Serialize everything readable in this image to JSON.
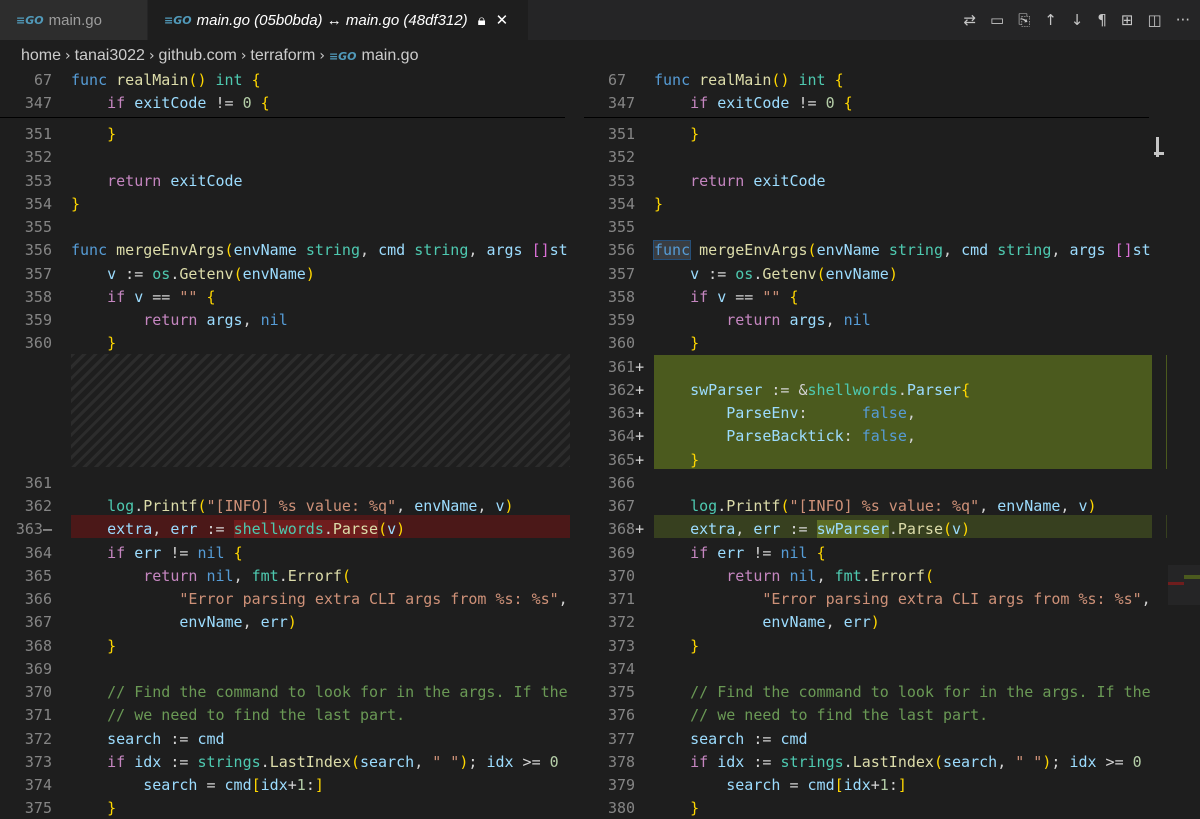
{
  "tabs": [
    {
      "label": "main.go",
      "icon": "go-file-icon"
    },
    {
      "label": "main.go (05b0bda) ↔ main.go (48df312)",
      "icon": "go-file-icon"
    }
  ],
  "toolbar_icons": [
    "git-compare-icon",
    "open-file-icon",
    "open-changes-icon",
    "arrow-up-icon",
    "arrow-down-icon",
    "pilcrow-icon",
    "book-icon",
    "split-editor-icon",
    "more-icon"
  ],
  "breadcrumb": [
    "home",
    "tanai3022",
    "github.com",
    "terraform",
    "main.go"
  ],
  "left": {
    "sticky": [
      {
        "ln": "67",
        "code": "func realMain() int {"
      },
      {
        "ln": "347",
        "code": "    if exitCode != 0 {"
      }
    ],
    "lines": [
      {
        "ln": "351",
        "code": "    }"
      },
      {
        "ln": "352",
        "code": ""
      },
      {
        "ln": "353",
        "code": "    return exitCode"
      },
      {
        "ln": "354",
        "code": "}"
      },
      {
        "ln": "355",
        "code": ""
      },
      {
        "ln": "356",
        "code": "func mergeEnvArgs(envName string, cmd string, args []st"
      },
      {
        "ln": "357",
        "code": "    v := os.Getenv(envName)"
      },
      {
        "ln": "358",
        "code": "    if v == \"\" {"
      },
      {
        "ln": "359",
        "code": "        return args, nil"
      },
      {
        "ln": "360",
        "code": "    }"
      },
      {
        "ln": "361",
        "code": ""
      },
      {
        "ln": "362",
        "code": "    log.Printf(\"[INFO] %s value: %q\", envName, v)"
      },
      {
        "ln": "363",
        "code": "    extra, err := shellwords.Parse(v)"
      },
      {
        "ln": "364",
        "code": "    if err != nil {"
      },
      {
        "ln": "365",
        "code": "        return nil, fmt.Errorf("
      },
      {
        "ln": "366",
        "code": "            \"Error parsing extra CLI args from %s: %s\","
      },
      {
        "ln": "367",
        "code": "            envName, err)"
      },
      {
        "ln": "368",
        "code": "    }"
      },
      {
        "ln": "369",
        "code": ""
      },
      {
        "ln": "370",
        "code": "    // Find the command to look for in the args. If the"
      },
      {
        "ln": "371",
        "code": "    // we need to find the last part."
      },
      {
        "ln": "372",
        "code": "    search := cmd"
      },
      {
        "ln": "373",
        "code": "    if idx := strings.LastIndex(search, \" \"); idx >= 0"
      },
      {
        "ln": "374",
        "code": "        search = cmd[idx+1:]"
      },
      {
        "ln": "375",
        "code": "    }"
      }
    ]
  },
  "right": {
    "sticky": [
      {
        "ln": "67",
        "code": "func realMain() int {"
      },
      {
        "ln": "347",
        "code": "    if exitCode != 0 {"
      }
    ],
    "lines": [
      {
        "ln": "351",
        "code": "    }"
      },
      {
        "ln": "352",
        "code": ""
      },
      {
        "ln": "353",
        "code": "    return exitCode"
      },
      {
        "ln": "354",
        "code": "}"
      },
      {
        "ln": "355",
        "code": ""
      },
      {
        "ln": "356",
        "code": "func mergeEnvArgs(envName string, cmd string, args []st"
      },
      {
        "ln": "357",
        "code": "    v := os.Getenv(envName)"
      },
      {
        "ln": "358",
        "code": "    if v == \"\" {"
      },
      {
        "ln": "359",
        "code": "        return args, nil"
      },
      {
        "ln": "360",
        "code": "    }"
      },
      {
        "ln": "361",
        "code": "",
        "sign": "+"
      },
      {
        "ln": "362",
        "code": "    swParser := &shellwords.Parser{",
        "sign": "+"
      },
      {
        "ln": "363",
        "code": "        ParseEnv:      false,",
        "sign": "+"
      },
      {
        "ln": "364",
        "code": "        ParseBacktick: false,",
        "sign": "+"
      },
      {
        "ln": "365",
        "code": "    }",
        "sign": "+"
      },
      {
        "ln": "366",
        "code": ""
      },
      {
        "ln": "367",
        "code": "    log.Printf(\"[INFO] %s value: %q\", envName, v)"
      },
      {
        "ln": "368",
        "code": "    extra, err := swParser.Parse(v)",
        "sign": "+"
      },
      {
        "ln": "369",
        "code": "    if err != nil {"
      },
      {
        "ln": "370",
        "code": "        return nil, fmt.Errorf("
      },
      {
        "ln": "371",
        "code": "            \"Error parsing extra CLI args from %s: %s\","
      },
      {
        "ln": "372",
        "code": "            envName, err)"
      },
      {
        "ln": "373",
        "code": "    }"
      },
      {
        "ln": "374",
        "code": ""
      },
      {
        "ln": "375",
        "code": "    // Find the command to look for in the args. If the"
      },
      {
        "ln": "376",
        "code": "    // we need to find the last part."
      },
      {
        "ln": "377",
        "code": "    search := cmd"
      },
      {
        "ln": "378",
        "code": "    if idx := strings.LastIndex(search, \" \"); idx >= 0"
      },
      {
        "ln": "379",
        "code": "        search = cmd[idx+1:]"
      },
      {
        "ln": "380",
        "code": "    }"
      }
    ]
  },
  "removed_sign": "—",
  "colors": {
    "inserted": "#4b5a1e",
    "removed": "#4b1818",
    "background": "#1e1e1e"
  }
}
